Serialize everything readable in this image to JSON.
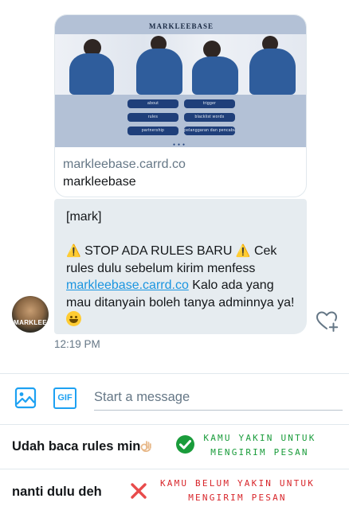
{
  "link_card": {
    "preview_title": "MARKLEEBASE",
    "preview_buttons": [
      "about",
      "trigger",
      "rules",
      "blacklist words",
      "partnership",
      "pelanggaran dan pencabutan"
    ],
    "domain": "markleebase.carrd.co",
    "site_name": "markleebase"
  },
  "message": {
    "line1": "[mark]",
    "warning_emoji": "⚠️",
    "body_part1": " STOP ADA RULES BARU ",
    "body_part2": " Cek rules dulu sebelum kirim menfess ",
    "link_text": "markleebase.carrd.co",
    "body_part3": "   Kalo ada yang mau ditanyain boleh tanya adminnya ya! ",
    "emoji": "grinning-face"
  },
  "avatar": {
    "label": "MARKLEE"
  },
  "timestamp": "12:19 PM",
  "composer": {
    "gif_label": "GIF",
    "placeholder": "Start a message"
  },
  "options": [
    {
      "label": "Udah baca rules min",
      "note_line1": "KAMU YAKIN UNTUK",
      "note_line2": "MENGIRIM PESAN",
      "note_color": "#1a9c3b"
    },
    {
      "label": "nanti dulu deh",
      "note_line1": "KAMU BELUM YAKIN UNTUK",
      "note_line2": "MENGIRIM PESAN",
      "note_color": "#d8262b"
    }
  ],
  "colors": {
    "accent": "#1da1f2",
    "bubble": "#e6ecf0",
    "muted": "#657786",
    "check_green": "#1a9c3b",
    "cross_red": "#e84b4b"
  }
}
